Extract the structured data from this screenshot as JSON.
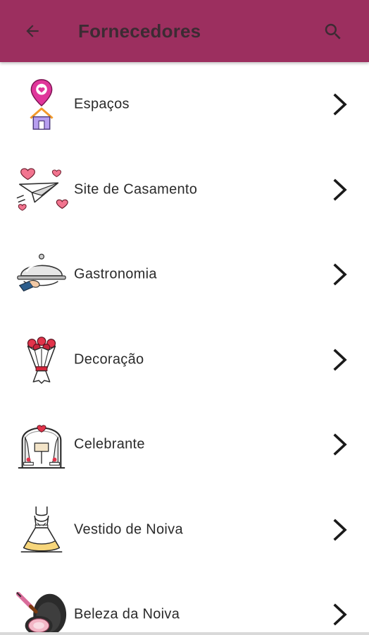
{
  "appbar": {
    "title": "Fornecedores",
    "back_icon": "arrow-back-icon",
    "search_icon": "search-icon",
    "background": "#9c2f5f"
  },
  "items": [
    {
      "label": "Espaços",
      "icon": "venue-pin-icon"
    },
    {
      "label": "Site de Casamento",
      "icon": "paper-plane-hearts-icon"
    },
    {
      "label": "Gastronomia",
      "icon": "cloche-icon"
    },
    {
      "label": "Decoração",
      "icon": "flower-bouquet-icon"
    },
    {
      "label": "Celebrante",
      "icon": "wedding-arch-icon"
    },
    {
      "label": "Vestido de Noiva",
      "icon": "wedding-dress-icon"
    },
    {
      "label": "Beleza da Noiva",
      "icon": "makeup-compact-icon"
    }
  ]
}
